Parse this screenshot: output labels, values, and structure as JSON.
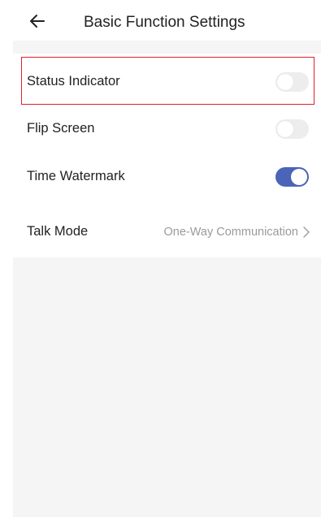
{
  "header": {
    "title": "Basic Function Settings",
    "back_icon": "arrow-left-icon"
  },
  "settings": {
    "status_indicator": {
      "label": "Status Indicator",
      "enabled": false
    },
    "flip_screen": {
      "label": "Flip Screen",
      "enabled": false
    },
    "time_watermark": {
      "label": "Time Watermark",
      "enabled": true
    },
    "talk_mode": {
      "label": "Talk Mode",
      "value": "One-Way Communication",
      "icon": "chevron-right-icon"
    }
  },
  "colors": {
    "toggle_on": "#4a65b8",
    "toggle_off": "#ededed",
    "highlight_border": "#e0202a",
    "panel_background": "#f5f5f5"
  }
}
